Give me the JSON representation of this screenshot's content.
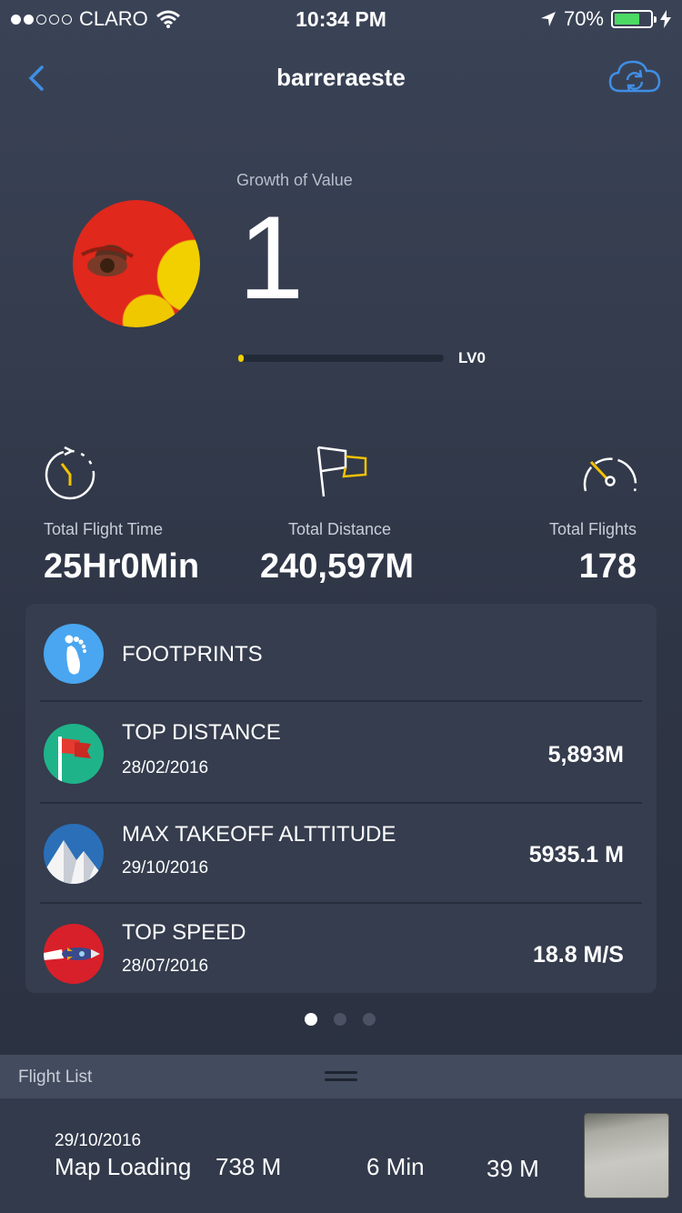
{
  "status_bar": {
    "carrier": "CLARO",
    "time": "10:34 PM",
    "battery": "70%",
    "battery_level": 0.7,
    "signal_bars": 2
  },
  "nav": {
    "title": "barreraeste",
    "back_icon": "chevron-left-icon",
    "sync_icon": "cloud-sync-icon"
  },
  "profile": {
    "growth_label": "Growth of Value",
    "growth_value": "1",
    "level_label": "LV0",
    "level_progress": 0.02
  },
  "stats": [
    {
      "icon": "stopwatch-icon",
      "label": "Total Flight Time",
      "value": "25Hr0Min"
    },
    {
      "icon": "flag-icon",
      "label": "Total Distance",
      "value": "240,597M"
    },
    {
      "icon": "speedometer-icon",
      "label": "Total Flights",
      "value": "178"
    }
  ],
  "footprints": {
    "title": "FOOTPRINTS",
    "items": [
      {
        "icon": "red-flag-icon",
        "title": "TOP DISTANCE",
        "date": "28/02/2016",
        "value": "5,893M"
      },
      {
        "icon": "mountain-icon",
        "title": "MAX TAKEOFF ALTTITUDE",
        "date": "29/10/2016",
        "value": "5935.1 M"
      },
      {
        "icon": "rocket-icon",
        "title": "TOP SPEED",
        "date": "28/07/2016",
        "value": "18.8 M/S"
      }
    ]
  },
  "pager": {
    "count": 3,
    "active": 0
  },
  "flight_list": {
    "header": "Flight List",
    "rows": [
      {
        "date": "29/10/2016",
        "location": "Map Loading",
        "altitude": "738 M",
        "duration": "6 Min",
        "distance": "39 M"
      }
    ]
  },
  "colors": {
    "accent_blue": "#3f8ee6",
    "accent_yellow": "#f2c200",
    "battery_green": "#4cd964",
    "footprint_blue": "#4aa6f0",
    "flag_green": "#1fb38a",
    "rocket_red": "#d8202a"
  }
}
